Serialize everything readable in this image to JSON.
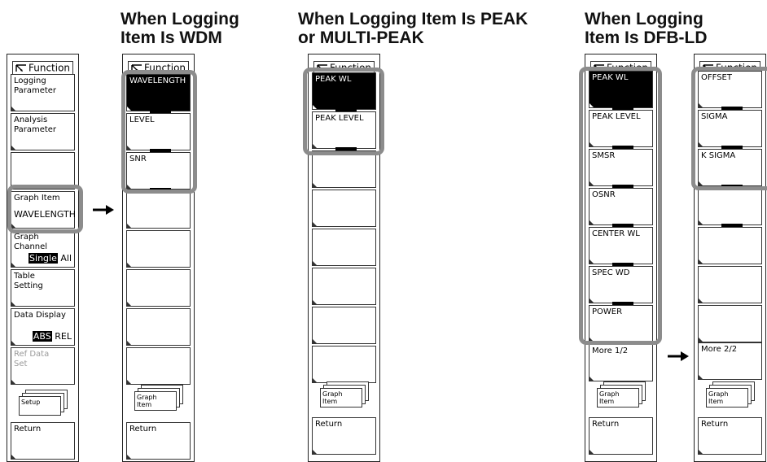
{
  "headings": {
    "wdm": "When Logging\nItem Is WDM",
    "peak": "When Logging Item Is PEAK\nor MULTI-PEAK",
    "dfb": "When Logging\nItem Is DFB-LD"
  },
  "panel_title": "Function",
  "main_menu": {
    "logging_parameter": "Logging\nParameter",
    "analysis_parameter": "Analysis\nParameter",
    "graph_item": "Graph Item",
    "graph_item_value": "WAVELENGTH",
    "graph_channel": "Graph\nChannel",
    "graph_channel_single": "Single",
    "graph_channel_all": "All",
    "table_setting": "Table\nSetting",
    "data_display": "Data Display",
    "data_display_abs": "ABS",
    "data_display_rel": "REL",
    "ref_data_set": "Ref Data\nSet",
    "setup": "Setup",
    "return": "Return"
  },
  "wdm_menu": {
    "items": [
      "WAVELENGTH",
      "LEVEL",
      "SNR"
    ],
    "graph_item": "Graph\nItem",
    "return": "Return"
  },
  "peak_menu": {
    "items": [
      "PEAK WL",
      "PEAK LEVEL"
    ],
    "graph_item": "Graph\nItem",
    "return": "Return"
  },
  "dfb_menu_1": {
    "items": [
      "PEAK WL",
      "PEAK LEVEL",
      "SMSR",
      "OSNR",
      "CENTER WL",
      "SPEC WD",
      "POWER"
    ],
    "more": "More 1/2",
    "graph_item": "Graph\nItem",
    "return": "Return"
  },
  "dfb_menu_2": {
    "items": [
      "OFFSET",
      "SIGMA",
      "K SIGMA"
    ],
    "more": "More 2/2",
    "graph_item": "Graph\nItem",
    "return": "Return"
  },
  "colors": {
    "highlight": "#8c8c8c",
    "selected": "#000000",
    "disabled_text": "#9a9a9a"
  },
  "icons": [
    "function-icon",
    "right-arrow-icon"
  ]
}
